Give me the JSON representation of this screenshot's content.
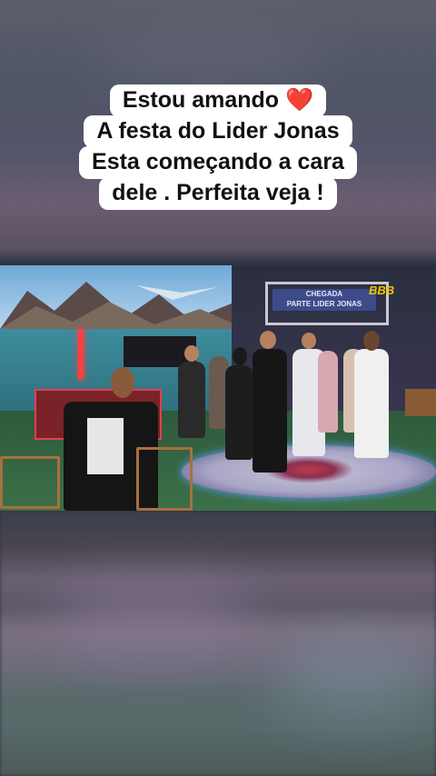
{
  "caption": {
    "lines": [
      "Estou amando",
      "A festa do Lider Jonas",
      "Esta começando a cara",
      "dele . Perfeita veja !"
    ],
    "heart_emoji": "❤️"
  },
  "video": {
    "sign_text_line1": "CHEGADA",
    "sign_text_line2": "PARTE LIDER JONAS",
    "channel_logo": "BBB"
  },
  "colors": {
    "caption_bg": "#ffffff",
    "heart": "#d11a2a",
    "logo": "#f5c400"
  }
}
